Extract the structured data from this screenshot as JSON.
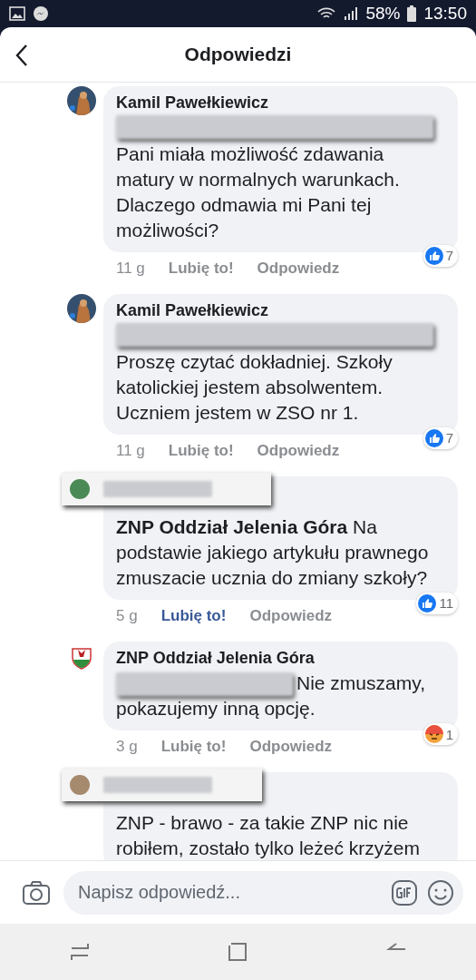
{
  "status_bar": {
    "battery": "58%",
    "time": "13:50"
  },
  "header": {
    "title": "Odpowiedzi"
  },
  "comments": [
    {
      "kind": "named",
      "author": "Kamil Pawełkiewicz",
      "mention_blurred": true,
      "body": "Pani miała możliwość zdawania matury w normalnych warunkach. Dlaczego odmawia mi Pani tej możliwości?",
      "time": "11 g",
      "like": {
        "label": "Lubię to!",
        "selected": false
      },
      "reply": "Odpowiedz",
      "reaction": {
        "kind": "like",
        "count": "7"
      },
      "avatar": {
        "kind": "photo"
      }
    },
    {
      "kind": "named",
      "author": "Kamil Pawełkiewicz",
      "mention_blurred": true,
      "body": "Proszę czytać dokładniej. Szkoły katolickiej jestem absolwentem. Uczniem jestem w ZSO nr 1.",
      "time": "11 g",
      "like": {
        "label": "Lubię to!",
        "selected": false
      },
      "reply": "Odpowiedz",
      "reaction": {
        "kind": "like",
        "count": "7"
      },
      "avatar": {
        "kind": "photo"
      }
    },
    {
      "kind": "blurred",
      "mention_blurred": false,
      "body": "**ZNP Oddział Jelenia Góra**  Na podstawie jakiego artykułu prawnego zmuszacie ucznia do zmiany szkoły?",
      "time": "5 g",
      "like": {
        "label": "Lubię to!",
        "selected": true
      },
      "reply": "Odpowiedz",
      "reaction": {
        "kind": "like",
        "count": "11"
      }
    },
    {
      "kind": "named",
      "author": "ZNP Oddział Jelenia Góra",
      "mention_blurred": true,
      "inline_mention": true,
      "body": "Nie zmuszamy, pokazujemy inną opcję.",
      "time": "3 g",
      "like": {
        "label": "Lubię to!",
        "selected": false
      },
      "reply": "Odpowiedz",
      "reaction": {
        "kind": "angry",
        "count": "1"
      },
      "avatar": {
        "kind": "crest"
      }
    },
    {
      "kind": "blurred",
      "mention_blurred": false,
      "body": "ZNP - brawo - za takie ZNP nic nie robiłem, zostało tylko leżeć krzyżem"
    }
  ],
  "composer": {
    "placeholder": "Napisz odpowiedź..."
  }
}
